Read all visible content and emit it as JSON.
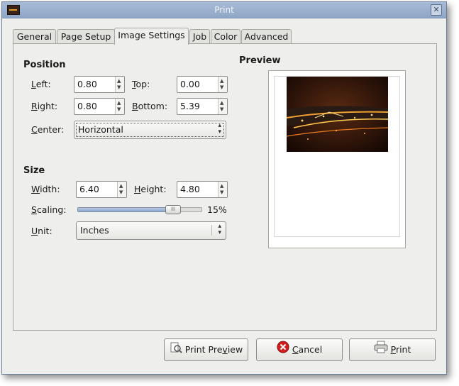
{
  "window": {
    "title": "Print"
  },
  "tabs": [
    {
      "label": "General"
    },
    {
      "label": "Page Setup"
    },
    {
      "label": "Image Settings"
    },
    {
      "label": "Job"
    },
    {
      "label": "Color"
    },
    {
      "label": "Advanced"
    }
  ],
  "position": {
    "heading": "Position",
    "left": {
      "mnemonic": "L",
      "rest": "eft:",
      "value": "0.80"
    },
    "top": {
      "mnemonic": "T",
      "rest": "op:",
      "value": "0.00"
    },
    "right": {
      "mnemonic": "R",
      "rest": "ight:",
      "value": "0.80"
    },
    "bottom": {
      "mnemonic": "B",
      "rest": "ottom:",
      "value": "5.39"
    },
    "center": {
      "mnemonic": "C",
      "rest": "enter:",
      "value": "Horizontal"
    }
  },
  "size": {
    "heading": "Size",
    "width": {
      "mnemonic": "W",
      "rest": "idth:",
      "value": "6.40"
    },
    "height": {
      "mnemonic": "H",
      "rest": "eight:",
      "value": "4.80"
    },
    "scaling": {
      "mnemonic": "S",
      "rest": "caling:",
      "value_text": "15%",
      "value_percent": 15
    },
    "unit": {
      "mnemonic": "U",
      "rest": "nit:",
      "value": "Inches"
    }
  },
  "preview": {
    "heading": "Preview"
  },
  "buttons": {
    "preview": {
      "pre": "Print Pre",
      "mnemonic": "v",
      "post": "iew"
    },
    "cancel": {
      "mnemonic": "C",
      "rest": "ancel"
    },
    "print": {
      "mnemonic": "P",
      "rest": "rint"
    }
  },
  "colors": {
    "titlebar": "#9fb4d2",
    "slider_fill": "#9db5d8",
    "cancel_red": "#d41c1c"
  }
}
